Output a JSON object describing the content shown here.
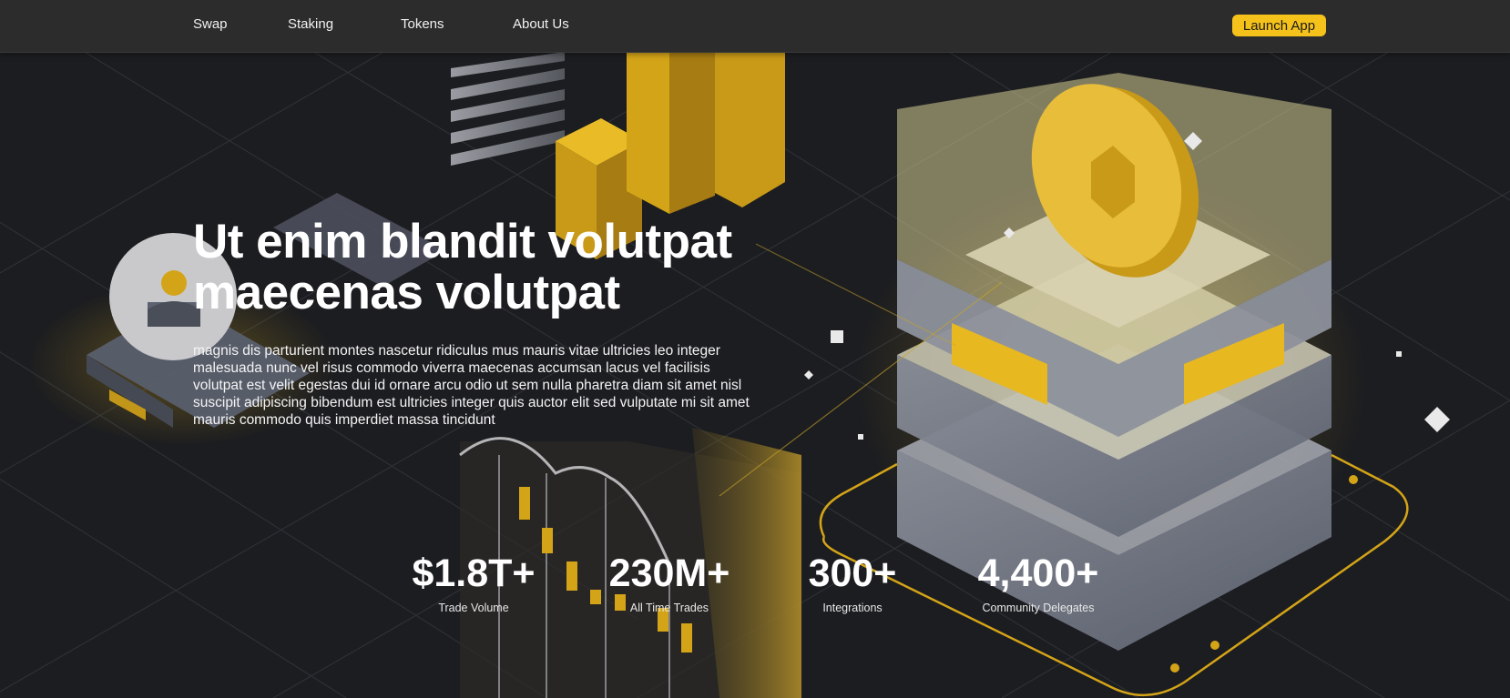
{
  "nav": {
    "links": [
      {
        "label": "Swap"
      },
      {
        "label": "Staking"
      },
      {
        "label": "Tokens"
      },
      {
        "label": "About Us"
      }
    ],
    "launch_label": "Launch App"
  },
  "hero": {
    "title_line1": "Ut enim blandit volutpat",
    "title_line2": "maecenas volutpat",
    "body": "magnis dis parturient montes nascetur ridiculus mus mauris vitae ultricies leo integer malesuada nunc vel risus commodo viverra maecenas accumsan lacus vel facilisis volutpat est velit egestas dui id ornare arcu odio ut sem nulla pharetra diam sit amet nisl suscipit adipiscing bibendum est ultricies integer quis auctor elit sed vulputate mi sit amet mauris commodo quis imperdiet massa tincidunt"
  },
  "stats": [
    {
      "value": "$1.8T+",
      "label": "Trade Volume"
    },
    {
      "value": "230M+",
      "label": "All Time Trades"
    },
    {
      "value": "300+",
      "label": "Integrations"
    },
    {
      "value": "4,400+",
      "label": "Community Delegates"
    }
  ],
  "colors": {
    "background": "#1c1d20",
    "nav": "#2c2c2d",
    "accent": "#f5c21b"
  },
  "icons": [
    "user-avatar-icon",
    "coin-icon",
    "diamond-sparkle-icon"
  ]
}
